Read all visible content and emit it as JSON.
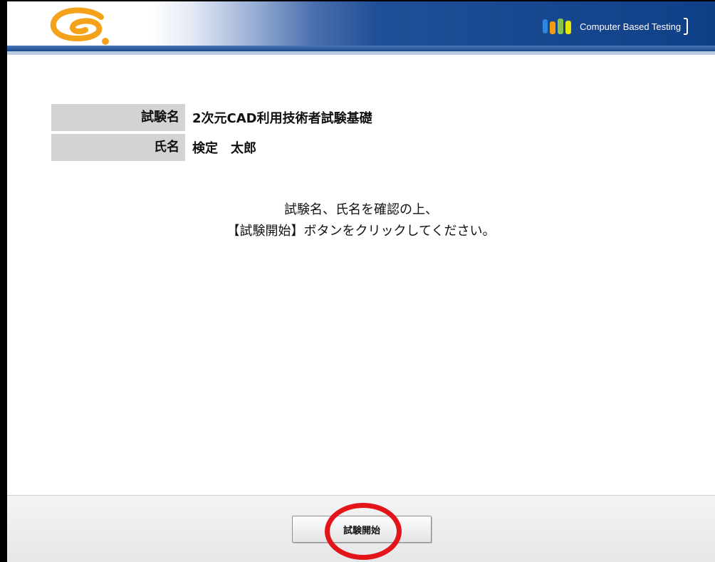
{
  "header": {
    "logo_icon": "cbt-s-logo-icon",
    "badge_icon": "cbt-people-icon",
    "badge_text": "Computer Based Testing"
  },
  "info": {
    "rows": [
      {
        "label": "試験名",
        "value": "2次元CAD利用技術者試験基礎"
      },
      {
        "label": "氏名",
        "value": "検定　太郎"
      }
    ]
  },
  "instructions": {
    "line1": "試験名、氏名を確認の上、",
    "line2": "【試験開始】ボタンをクリックしてください。"
  },
  "footer": {
    "start_button_label": "試験開始"
  },
  "colors": {
    "header_blue": "#0f3f86",
    "label_gray": "#d3d3d3",
    "highlight_red": "#e4141b",
    "logo_orange": "#f3a21a"
  }
}
